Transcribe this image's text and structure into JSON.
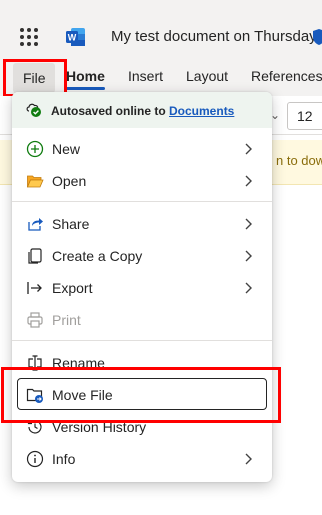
{
  "header": {
    "app_icon": "word-icon",
    "app_letter": "W",
    "document_title": "My test document on Thursday"
  },
  "ribbon": {
    "tabs": [
      "File",
      "Home",
      "Insert",
      "Layout",
      "References"
    ],
    "active_tab": "Home",
    "font_size": "12"
  },
  "banner": {
    "text": "n to dow"
  },
  "file_menu": {
    "autosave_text": "Autosaved online to ",
    "autosave_link": "Documents",
    "items": [
      {
        "label": "New",
        "icon": "plus-circle-icon",
        "submenu": true
      },
      {
        "label": "Open",
        "icon": "folder-open-icon",
        "submenu": true
      },
      {
        "label": "Share",
        "icon": "share-icon",
        "submenu": true
      },
      {
        "label": "Create a Copy",
        "icon": "copy-icon",
        "submenu": true
      },
      {
        "label": "Export",
        "icon": "export-icon",
        "submenu": true
      },
      {
        "label": "Print",
        "icon": "print-icon",
        "submenu": false,
        "disabled": true
      },
      {
        "label": "Rename",
        "icon": "rename-icon",
        "submenu": false
      },
      {
        "label": "Move File",
        "icon": "move-file-icon",
        "submenu": false,
        "focused": true
      },
      {
        "label": "Version History",
        "icon": "history-icon",
        "submenu": false
      },
      {
        "label": "Info",
        "icon": "info-icon",
        "submenu": true
      }
    ]
  },
  "colors": {
    "accent": "#185abd",
    "highlight_red": "#ff0000",
    "autosave_green": "#107c10",
    "open_folder": "#f7a723"
  }
}
